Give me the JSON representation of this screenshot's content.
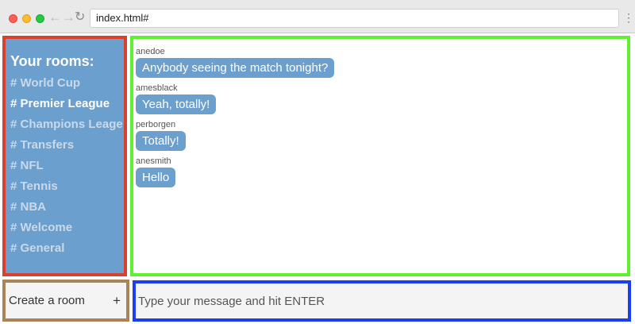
{
  "browser": {
    "url": "index.html#",
    "back_glyph": "←",
    "forward_glyph": "→",
    "reload_glyph": "↻",
    "menu_glyph": "⋮"
  },
  "sidebar": {
    "heading": "Your rooms:",
    "rooms": [
      {
        "label": "# World Cup",
        "active": false
      },
      {
        "label": "# Premier League",
        "active": true
      },
      {
        "label": "# Champions Leage",
        "active": false
      },
      {
        "label": "# Transfers",
        "active": false
      },
      {
        "label": "# NFL",
        "active": false
      },
      {
        "label": "# Tennis",
        "active": false
      },
      {
        "label": "# NBA",
        "active": false
      },
      {
        "label": "# Welcome",
        "active": false
      },
      {
        "label": "# General",
        "active": false
      }
    ]
  },
  "messages": [
    {
      "user": "anedoe",
      "text": "Anybody seeing the match tonight?"
    },
    {
      "user": "amesblack",
      "text": "Yeah, totally!"
    },
    {
      "user": "perborgen",
      "text": "Totally!"
    },
    {
      "user": "anesmith",
      "text": "Hello"
    }
  ],
  "new_room": {
    "label": "Create a room",
    "plus": "+"
  },
  "composer": {
    "placeholder": "Type your message and hit ENTER"
  },
  "colors": {
    "sidebar_bg": "#6b9fcd",
    "bubble_bg": "#6b9fcd",
    "sidebar_outline": "#d8412f",
    "messages_outline": "#5ff02f",
    "new_room_outline": "#a88457",
    "composer_outline": "#1c3ef0"
  }
}
